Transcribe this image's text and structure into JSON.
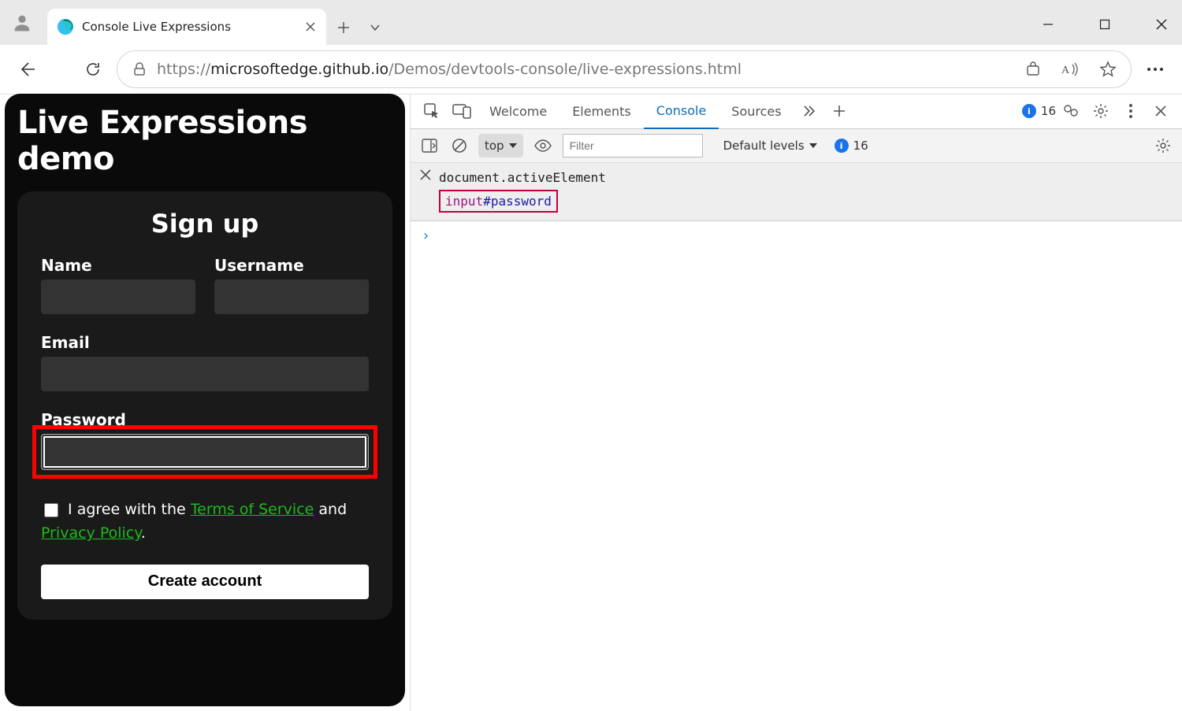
{
  "browser": {
    "tab_title": "Console Live Expressions",
    "url_protocol": "https://",
    "url_host": "microsoftedge.github.io",
    "url_path": "/Demos/devtools-console/live-expressions.html"
  },
  "page": {
    "title": "Live Expressions demo",
    "signup_heading": "Sign up",
    "labels": {
      "name": "Name",
      "username": "Username",
      "email": "Email",
      "password": "Password"
    },
    "agree_prefix": "I agree with the ",
    "tos": "Terms of Service",
    "agree_mid": " and ",
    "privacy": "Privacy Policy",
    "agree_suffix": ".",
    "create_btn": "Create account"
  },
  "devtools": {
    "tabs": {
      "welcome": "Welcome",
      "elements": "Elements",
      "console": "Console",
      "sources": "Sources"
    },
    "error_count": "16",
    "toolbar": {
      "context": "top",
      "filter_placeholder": "Filter",
      "levels": "Default levels",
      "msg_count": "16"
    },
    "live_expression": {
      "code": "document.activeElement",
      "result_tag": "input",
      "result_hash": "#",
      "result_id": "password"
    }
  }
}
